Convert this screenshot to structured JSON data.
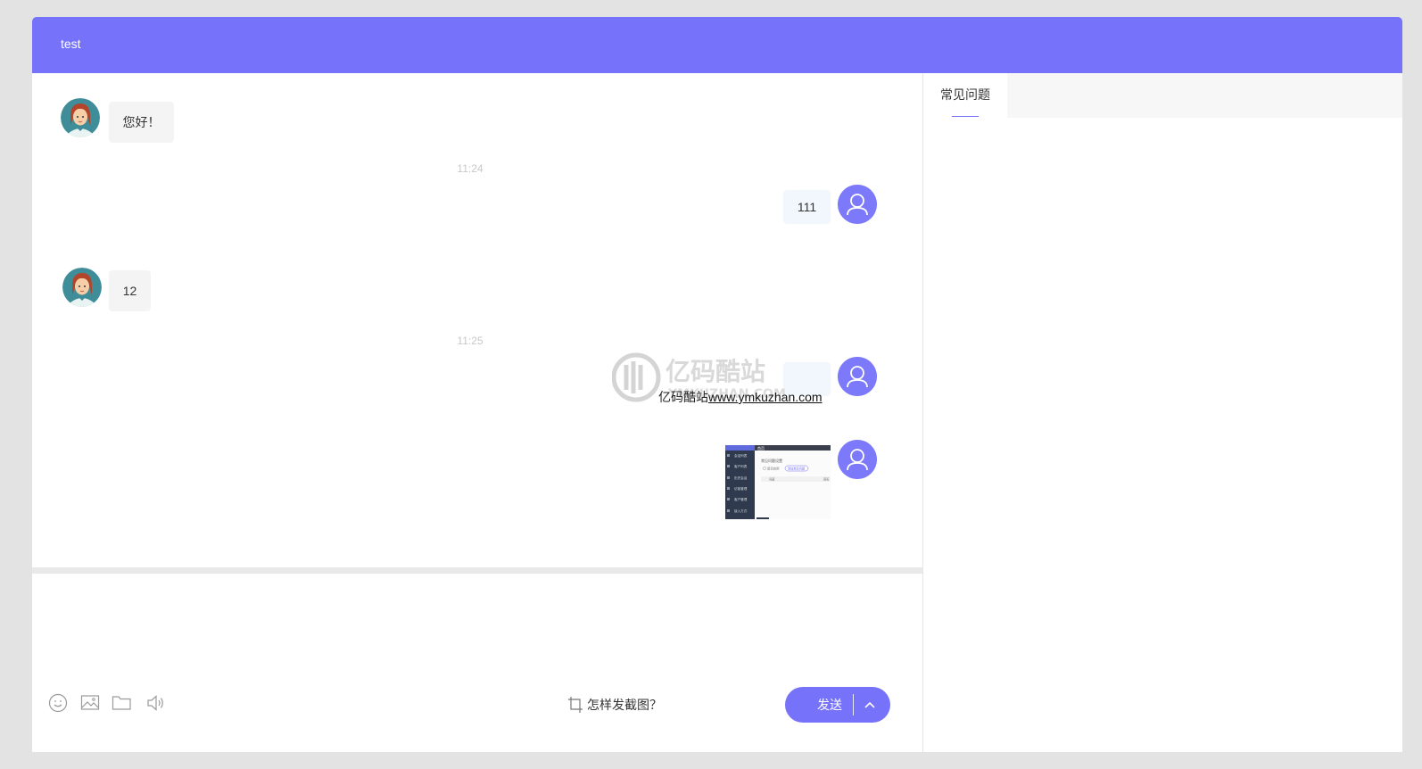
{
  "header": {
    "title": "test"
  },
  "messages": {
    "m1": {
      "text": "您好！"
    },
    "t1": {
      "text": "11:24"
    },
    "m2": {
      "text": "111"
    },
    "m3": {
      "text": "12"
    },
    "t2": {
      "text": "11:25"
    },
    "m4": {
      "link_prefix": "亿码酷站",
      "link_text": "www.ymkuzhan.com"
    }
  },
  "watermark": {
    "cn": "亿码酷站",
    "en": "YMKUZHAN.COM"
  },
  "thumbnail": {
    "tab": "首页",
    "heading": "常见问题设置",
    "checkbox_label": "是否启用",
    "button_label": "添加常见问题",
    "column_left": "问题",
    "column_right": "回答",
    "menu": [
      "会话列表",
      "客户列表",
      "历史会话",
      "访客管理",
      "客户管理",
      "接入方式"
    ]
  },
  "toolbar": {
    "icons": [
      "emoji-icon",
      "image-icon",
      "folder-icon",
      "voice-icon"
    ],
    "screenshot_help": "怎样发截图？",
    "send_label": "发送"
  },
  "faq": {
    "tab_label": "常见问题"
  },
  "colors": {
    "accent": "#7672fa",
    "avatar_user": "#7d79fb"
  }
}
